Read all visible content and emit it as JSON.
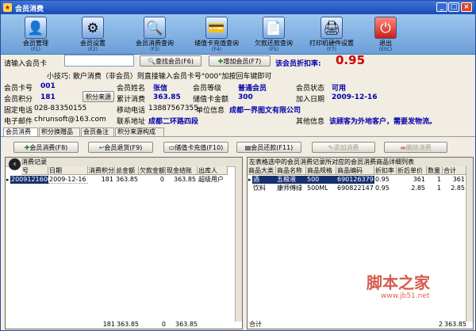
{
  "window": {
    "title": "会员消费"
  },
  "toolbar": [
    {
      "label": "会员管理",
      "key": "(F1)"
    },
    {
      "label": "会员设置",
      "key": "(F2)"
    },
    {
      "label": "会员消费",
      "label2": "查询",
      "key": "(F3)"
    },
    {
      "label": "储值卡充值",
      "label2": "查询",
      "key": "(F4)"
    },
    {
      "label": "欠款还款",
      "label2": "查询",
      "key": "(F5)"
    },
    {
      "label": "打印机硬件",
      "label2": "设置",
      "key": "(F7)"
    },
    {
      "label": "退出",
      "key": "(ESC)"
    }
  ],
  "search": {
    "label": "请输入会员卡",
    "value": "",
    "find_button": "查找会员(F6)",
    "add_button": "增加会员(F7)",
    "discount_label": "该会员折扣率:",
    "discount_value": "0.95",
    "tip": "小技巧: 散户消费（非会员）则直接输入会员卡号\"000\"加按回车键即可"
  },
  "member": {
    "card_label": "会员卡号",
    "card_value": "001",
    "name_label": "会员姓名",
    "name_value": "张信",
    "level_label": "会员等级",
    "level_value": "普通会员",
    "status_label": "会员状态",
    "status_value": "可用",
    "points_label": "会员积分",
    "points_value": "181",
    "points_source_button": "积分来源",
    "total_label": "累计消费",
    "total_value": "363.85",
    "stored_label": "储值卡金额",
    "stored_value": "300",
    "join_label": "加入日期",
    "join_value": "2009-12-16",
    "phone_label": "固定电话",
    "phone_value": "028-83350155",
    "mobile_label": "移动电话",
    "mobile_value": "13887567355",
    "unit_label": "单位信息",
    "unit_value": "成都一界图文有限公司",
    "email_label": "电子邮件",
    "email_value": "chrunsoft@163.com",
    "address_label": "联系地址",
    "address_value": "成都二环路四段",
    "other_label": "其他信息",
    "other_value": "该顾客为外地客户，需要发物流。"
  },
  "tabs": [
    "会员消费",
    "积分换赠品",
    "会员备注",
    "积分来源构成"
  ],
  "actions": {
    "consume": "会员消费(F8)",
    "return": "会员退货(F9)",
    "recharge": "储值卡充值(F10)",
    "repay": "会员还款(F11)",
    "add_consume": "添加消费",
    "delete_consume": "删除消费"
  },
  "left_panel": {
    "title": "消费记录",
    "columns": [
      "号",
      "日期",
      "消费积分",
      "总金额",
      "欠款金额",
      "现金结账",
      "出库人"
    ],
    "rows": [
      [
        "2009121600",
        "2009-12-16",
        "181",
        "363.85",
        "0",
        "363.85",
        "超级用户"
      ]
    ],
    "footer": {
      "points": "181",
      "total": "363.85",
      "debt": "0",
      "cash": "363.85"
    }
  },
  "right_panel": {
    "title": "左表格选中的会员消费记录所对应的会员消费商品详细列表",
    "columns": [
      "商品大类",
      "商品名称",
      "商品规格",
      "商品编码",
      "折扣率",
      "折后单价",
      "数量",
      "合计"
    ],
    "rows": [
      [
        "酒",
        "五粮液",
        "500",
        "690126379",
        "0.95",
        "361",
        "1",
        "361"
      ],
      [
        "饮料",
        "康师傅绿",
        "500ML",
        "690822147",
        "0.95",
        "2.85",
        "1",
        "2.85"
      ]
    ],
    "footer": {
      "label": "合计",
      "qty": "2",
      "total": "363.85"
    }
  },
  "watermark": {
    "text": "脚本之家",
    "url": "www.jb51.net"
  },
  "colors": {
    "title_bar": "#1c4cb4",
    "toolbar": "#6c9ed8",
    "discount": "#d00000",
    "accent_text": "#0000aa",
    "selection": "#16306e"
  }
}
